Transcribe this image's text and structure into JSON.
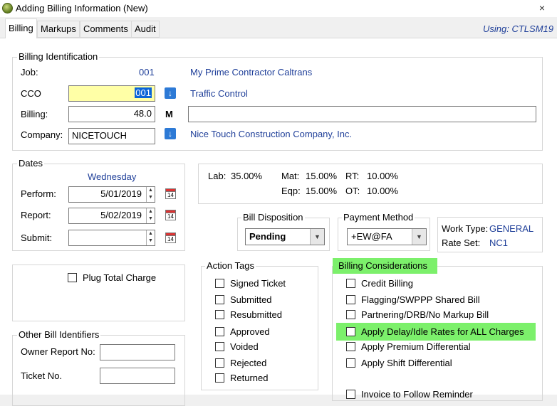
{
  "window": {
    "title": "Adding Billing Information  (New)",
    "close_glyph": "×"
  },
  "tabs": [
    {
      "label": "Billing"
    },
    {
      "label": "Markups"
    },
    {
      "label": "Comments"
    },
    {
      "label": "Audit"
    }
  ],
  "using_label": "Using: CTLSM19",
  "billing_identification": {
    "legend": "Billing Identification",
    "job_label": "Job:",
    "job_value": "001",
    "job_name": "My Prime Contractor Caltrans",
    "cco_label": "CCO",
    "cco_value": "001",
    "cco_name": "Traffic Control",
    "billing_label": "Billing:",
    "billing_value": "48.0",
    "billing_suffix": "M",
    "billing_desc": "",
    "company_label": "Company:",
    "company_value": "NICETOUCH",
    "company_name": "Nice Touch Construction Company, Inc."
  },
  "dates": {
    "legend": "Dates",
    "weekday": "Wednesday",
    "perform_label": "Perform:",
    "perform_value": "5/01/2019",
    "report_label": "Report:",
    "report_value": "5/02/2019",
    "submit_label": "Submit:",
    "submit_value": "",
    "calendar_day": "14"
  },
  "rates": {
    "lab_label": "Lab:",
    "lab_value": "35.00%",
    "mat_label": "Mat:",
    "mat_value": "15.00%",
    "rt_label": "RT:",
    "rt_value": "10.00%",
    "eqp_label": "Eqp:",
    "eqp_value": "15.00%",
    "ot_label": "OT:",
    "ot_value": "10.00%"
  },
  "bill_disposition": {
    "legend": "Bill Disposition",
    "selected": "Pending"
  },
  "payment_method": {
    "legend": "Payment Method",
    "selected": "+EW@FA"
  },
  "work_info": {
    "work_type_label": "Work Type:",
    "work_type_value": "GENERAL",
    "rate_set_label": "Rate Set:",
    "rate_set_value": "NC1"
  },
  "plug_total": {
    "label": "Plug Total Charge",
    "checked": false
  },
  "other_bill_identifiers": {
    "legend": "Other Bill Identifiers",
    "owner_report_label": "Owner Report No:",
    "owner_report_value": "",
    "ticket_label": "Ticket No.",
    "ticket_value": ""
  },
  "action_tags": {
    "legend": "Action Tags",
    "items": [
      {
        "label": "Signed Ticket",
        "checked": false
      },
      {
        "label": "Submitted",
        "checked": false
      },
      {
        "label": "Resubmitted",
        "checked": false
      },
      {
        "label": "Approved",
        "checked": false
      },
      {
        "label": "Voided",
        "checked": false
      },
      {
        "label": "Rejected",
        "checked": false
      },
      {
        "label": "Returned",
        "checked": false
      }
    ]
  },
  "billing_considerations": {
    "legend": "Billing Considerations",
    "items": [
      {
        "label": "Credit Billing",
        "checked": false
      },
      {
        "label": "Flagging/SWPPP Shared Bill",
        "checked": false
      },
      {
        "label": "Partnering/DRB/No Markup Bill",
        "checked": false
      },
      {
        "label": "Apply Delay/Idle Rates for ALL Charges",
        "checked": false
      },
      {
        "label": "Apply Premium Differential",
        "checked": false
      },
      {
        "label": "Apply Shift Differential",
        "checked": false
      },
      {
        "label": "Invoice to Follow Reminder",
        "checked": false
      }
    ]
  },
  "colors": {
    "highlight": "#7cf06b",
    "accent_blue": "#1f3f99",
    "cco_field_bg": "#ffffa6",
    "selection_bg": "#0a64d8"
  }
}
